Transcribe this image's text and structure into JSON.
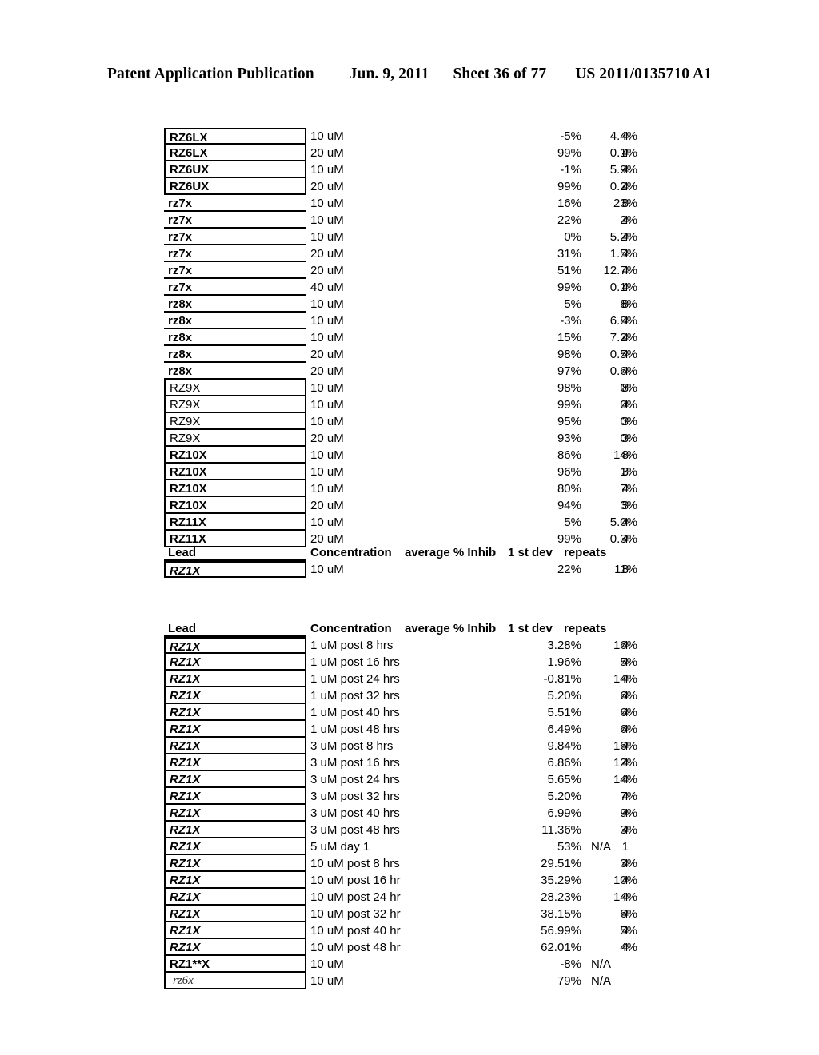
{
  "page_header": {
    "publication": "Patent Application Publication",
    "date": "Jun. 9, 2011",
    "sheet": "Sheet 36 of 77",
    "patent_number": "US 2011/0135710 A1"
  },
  "columns": {
    "lead": "Lead",
    "concentration": "Concentration",
    "average_inhib": "average % Inhib",
    "std_dev": "1 st dev",
    "repeats": "repeats"
  },
  "table1": {
    "rows": [
      {
        "lead": "RZ6LX",
        "style": "boxed-bold-first",
        "concentration": "10 uM",
        "inhib": "-5%",
        "stdev": "4.4%",
        "repeats": "4"
      },
      {
        "lead": "RZ6LX",
        "style": "boxed-bold",
        "concentration": "20 uM",
        "inhib": "99%",
        "stdev": "0.1%",
        "repeats": "4"
      },
      {
        "lead": "RZ6UX",
        "style": "boxed-bold",
        "concentration": "10 uM",
        "inhib": "-1%",
        "stdev": "5.9%",
        "repeats": "4"
      },
      {
        "lead": "RZ6UX",
        "style": "boxed-bold",
        "concentration": "20 uM",
        "inhib": "99%",
        "stdev": "0.2%",
        "repeats": "4"
      },
      {
        "lead": "rz7x",
        "style": "plain-bold",
        "concentration": "10 uM",
        "inhib": "16%",
        "stdev": "23%",
        "repeats": "8"
      },
      {
        "lead": "rz7x",
        "style": "plain-bold",
        "concentration": "10 uM",
        "inhib": "22%",
        "stdev": "2%",
        "repeats": "4"
      },
      {
        "lead": "rz7x",
        "style": "plain-bold",
        "concentration": "10 uM",
        "inhib": "0%",
        "stdev": "5.2%",
        "repeats": "4"
      },
      {
        "lead": "rz7x",
        "style": "plain-bold",
        "concentration": "20 uM",
        "inhib": "31%",
        "stdev": "1.5%",
        "repeats": "4"
      },
      {
        "lead": "rz7x",
        "style": "plain-bold",
        "concentration": "20 uM",
        "inhib": "51%",
        "stdev": "12.7%",
        "repeats": "4"
      },
      {
        "lead": "rz7x",
        "style": "plain-bold",
        "concentration": "40 uM",
        "inhib": "99%",
        "stdev": "0.1%",
        "repeats": "4"
      },
      {
        "lead": "rz8x",
        "style": "plain-bold",
        "concentration": "10 uM",
        "inhib": "5%",
        "stdev": "8%",
        "repeats": "8"
      },
      {
        "lead": "rz8x",
        "style": "plain-bold",
        "concentration": "10 uM",
        "inhib": "-3%",
        "stdev": "6.8%",
        "repeats": "4"
      },
      {
        "lead": "rz8x",
        "style": "plain-bold",
        "concentration": "10 uM",
        "inhib": "15%",
        "stdev": "7.2%",
        "repeats": "4"
      },
      {
        "lead": "rz8x",
        "style": "plain-bold",
        "concentration": "20 uM",
        "inhib": "98%",
        "stdev": "0.5%",
        "repeats": "4"
      },
      {
        "lead": "rz8x",
        "style": "plain-bold",
        "concentration": "20 uM",
        "inhib": "97%",
        "stdev": "0.6%",
        "repeats": "4"
      },
      {
        "lead": "RZ9X",
        "style": "boxed-regular",
        "concentration": "10 uM",
        "inhib": "98%",
        "stdev": "0%",
        "repeats": "8"
      },
      {
        "lead": "RZ9X",
        "style": "boxed-regular",
        "concentration": "10 uM",
        "inhib": "99%",
        "stdev": "0%",
        "repeats": "4"
      },
      {
        "lead": "RZ9X",
        "style": "boxed-regular",
        "concentration": "10 uM",
        "inhib": "95%",
        "stdev": "0%",
        "repeats": "3"
      },
      {
        "lead": "RZ9X",
        "style": "boxed-regular",
        "concentration": "20 uM",
        "inhib": "93%",
        "stdev": "0%",
        "repeats": "3"
      },
      {
        "lead": "RZ10X",
        "style": "boxed-bold",
        "concentration": "10 uM",
        "inhib": "86%",
        "stdev": "14%",
        "repeats": "8"
      },
      {
        "lead": "RZ10X",
        "style": "boxed-bold",
        "concentration": "10 uM",
        "inhib": "96%",
        "stdev": "1%",
        "repeats": "3"
      },
      {
        "lead": "RZ10X",
        "style": "boxed-bold",
        "concentration": "10 uM",
        "inhib": "80%",
        "stdev": "7%",
        "repeats": "4"
      },
      {
        "lead": "RZ10X",
        "style": "boxed-bold",
        "concentration": "20 uM",
        "inhib": "94%",
        "stdev": "3%",
        "repeats": "3"
      },
      {
        "lead": "RZ11X",
        "style": "boxed-bold",
        "concentration": "10 uM",
        "inhib": "5%",
        "stdev": "5.0%",
        "repeats": "4"
      },
      {
        "lead": "RZ11X",
        "style": "boxed-bold",
        "concentration": "20 uM",
        "inhib": "99%",
        "stdev": "0.3%",
        "repeats": "4"
      }
    ]
  },
  "table2": {
    "rows": [
      {
        "lead": "RZ1X",
        "style": "boxed-bold-ital-first",
        "concentration": "10 uM",
        "inhib": "22%",
        "stdev": "11%",
        "repeats": "8"
      }
    ]
  },
  "table3": {
    "rows": [
      {
        "lead": "RZ1X",
        "style": "boxed-bold-ital-first",
        "concentration": "1 uM post 8 hrs",
        "inhib": "3.28%",
        "stdev": "16%",
        "repeats": "4"
      },
      {
        "lead": "RZ1X",
        "style": "boxed-bold-ital",
        "concentration": "1 uM post 16 hrs",
        "inhib": "1.96%",
        "stdev": "5%",
        "repeats": "4"
      },
      {
        "lead": "RZ1X",
        "style": "boxed-bold-ital",
        "concentration": "1 uM post 24 hrs",
        "inhib": "-0.81%",
        "stdev": "14%",
        "repeats": "4"
      },
      {
        "lead": "RZ1X",
        "style": "boxed-bold-ital",
        "concentration": "1 uM post 32 hrs",
        "inhib": "5.20%",
        "stdev": "6%",
        "repeats": "4"
      },
      {
        "lead": "RZ1X",
        "style": "boxed-bold-ital",
        "concentration": "1 uM post 40 hrs",
        "inhib": "5.51%",
        "stdev": "6%",
        "repeats": "4"
      },
      {
        "lead": "RZ1X",
        "style": "boxed-bold-ital",
        "concentration": "1 uM post 48 hrs",
        "inhib": "6.49%",
        "stdev": "6%",
        "repeats": "4"
      },
      {
        "lead": "RZ1X",
        "style": "boxed-bold-ital",
        "concentration": "3 uM post 8 hrs",
        "inhib": "9.84%",
        "stdev": "16%",
        "repeats": "4"
      },
      {
        "lead": "RZ1X",
        "style": "boxed-bold-ital",
        "concentration": "3 uM post 16 hrs",
        "inhib": "6.86%",
        "stdev": "12%",
        "repeats": "4"
      },
      {
        "lead": "RZ1X",
        "style": "boxed-bold-ital",
        "concentration": "3 uM post 24 hrs",
        "inhib": "5.65%",
        "stdev": "14%",
        "repeats": "4"
      },
      {
        "lead": "RZ1X",
        "style": "boxed-bold-ital",
        "concentration": "3 uM post 32 hrs",
        "inhib": "5.20%",
        "stdev": "7%",
        "repeats": "4"
      },
      {
        "lead": "RZ1X",
        "style": "boxed-bold-ital",
        "concentration": "3 uM post 40 hrs",
        "inhib": "6.99%",
        "stdev": "9%",
        "repeats": "4"
      },
      {
        "lead": "RZ1X",
        "style": "boxed-bold-ital",
        "concentration": "3 uM post 48 hrs",
        "inhib": "11.36%",
        "stdev": "3%",
        "repeats": "4"
      },
      {
        "lead": "RZ1X",
        "style": "boxed-bold-ital",
        "concentration": "5 uM day 1",
        "inhib": "53%",
        "stdev": "N/A",
        "repeats": "1"
      },
      {
        "lead": "RZ1X",
        "style": "boxed-bold-ital",
        "concentration": "10 uM post 8 hrs",
        "inhib": "29.51%",
        "stdev": "3%",
        "repeats": "4"
      },
      {
        "lead": "RZ1X",
        "style": "boxed-bold-ital",
        "concentration": "10 uM post 16 hr",
        "inhib": "35.29%",
        "stdev": "10%",
        "repeats": "4"
      },
      {
        "lead": "RZ1X",
        "style": "boxed-bold-ital",
        "concentration": "10 uM post 24 hr",
        "inhib": "28.23%",
        "stdev": "14%",
        "repeats": "4"
      },
      {
        "lead": "RZ1X",
        "style": "boxed-bold-ital",
        "concentration": "10 uM post 32 hr",
        "inhib": "38.15%",
        "stdev": "6%",
        "repeats": "4"
      },
      {
        "lead": "RZ1X",
        "style": "boxed-bold-ital",
        "concentration": "10 uM post 40 hr",
        "inhib": "56.99%",
        "stdev": "5%",
        "repeats": "4"
      },
      {
        "lead": "RZ1X",
        "style": "boxed-bold-ital",
        "concentration": "10 uM post 48 hr",
        "inhib": "62.01%",
        "stdev": "4%",
        "repeats": "4"
      },
      {
        "lead": "RZ1**X",
        "style": "boxed-bold",
        "concentration": "10 uM",
        "inhib": "-8%",
        "stdev": "N/A",
        "repeats": ""
      },
      {
        "lead": "rz6x",
        "style": "boxed-serif-ital",
        "concentration": "10 uM",
        "inhib": "79%",
        "stdev": "N/A",
        "repeats": ""
      }
    ]
  }
}
